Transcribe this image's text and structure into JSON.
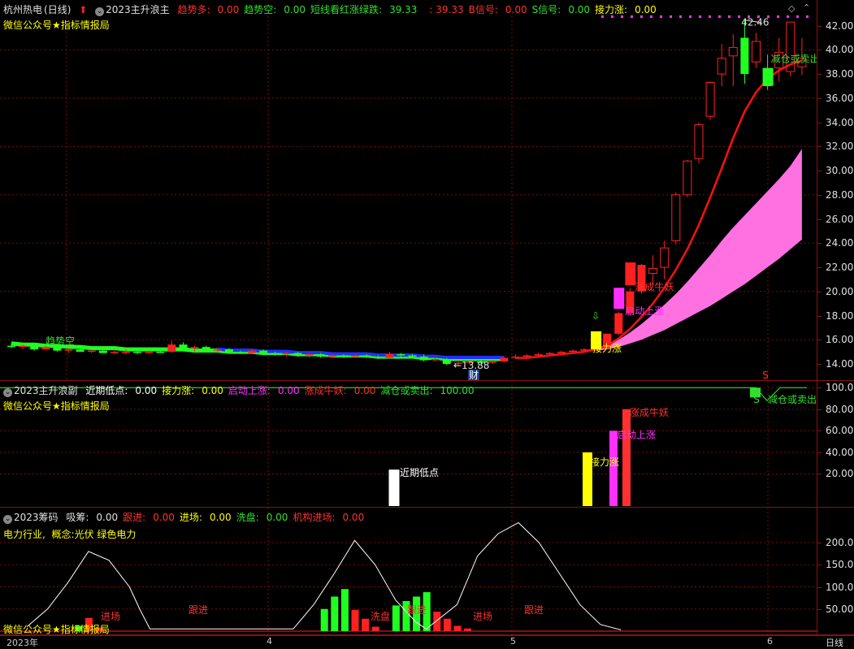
{
  "main_panel": {
    "stock_name": "杭州热电",
    "period": "(日线)",
    "indicator_name": "2023主升浪主",
    "fields": [
      {
        "label": "趋势多:",
        "value": "0.00",
        "color": "#ff3030"
      },
      {
        "label": "趋势空:",
        "value": "0.00",
        "color": "#30e030"
      },
      {
        "label": "短线看红涨绿跌:",
        "value": "39.33",
        "color": "#30e030"
      },
      {
        "label": "",
        "value": ": 39.33",
        "color": "#ff3030"
      },
      {
        "label": "B信号:",
        "value": "0.00",
        "color": "#ff3030"
      },
      {
        "label": "S信号:",
        "value": "0.00",
        "color": "#30e030"
      },
      {
        "label": "接力涨:",
        "value": "0.00",
        "color": "#ffff00"
      }
    ],
    "subtitle": "微信公众号★指标情报局",
    "annotations": {
      "high": "42.46",
      "low": "13.88",
      "trend_empty": "趋势空",
      "relay": "接力涨",
      "start": "启动上涨",
      "bull": "涨成牛妖",
      "reduce": "减仓或卖出",
      "cai": "财",
      "s_mark": "S"
    },
    "y_ticks": [
      "42.00",
      "40.00",
      "38.00",
      "36.00",
      "34.00",
      "32.00",
      "30.00",
      "28.00",
      "26.00",
      "24.00",
      "22.00",
      "20.00",
      "18.00",
      "16.00",
      "14.00"
    ]
  },
  "sub_panel": {
    "indicator_name": "2023主升浪副",
    "fields": [
      {
        "label": "近期低点:",
        "value": "0.00",
        "color": "#ffffff"
      },
      {
        "label": "接力涨:",
        "value": "0.00",
        "color": "#ffff00"
      },
      {
        "label": "启动上涨:",
        "value": "0.00",
        "color": "#ff30ff"
      },
      {
        "label": "涨成牛妖:",
        "value": "0.00",
        "color": "#ff3030"
      },
      {
        "label": "减仓或卖出:",
        "value": "100.00",
        "color": "#30e030"
      }
    ],
    "subtitle": "微信公众号★指标情报局",
    "annotations": {
      "recent_low": "近期低点",
      "relay": "接力涨",
      "start": "启动上涨",
      "bull": "涨成牛妖",
      "reduce": "减仓或卖出",
      "s_mark": "S"
    },
    "y_ticks": [
      "100.00",
      "80.00",
      "60.00",
      "40.00",
      "20.00"
    ]
  },
  "chip_panel": {
    "indicator_name": "2023筹码",
    "fields": [
      {
        "label": "吸筹:",
        "value": "0.00",
        "color": "#e0e0e0"
      },
      {
        "label": "跟进:",
        "value": "0.00",
        "color": "#ff3030"
      },
      {
        "label": "进场:",
        "value": "0.00",
        "color": "#ffff00"
      },
      {
        "label": "洗盘:",
        "value": "0.00",
        "color": "#30e030"
      },
      {
        "label": "机构进场:",
        "value": "0.00",
        "color": "#ff3030"
      }
    ],
    "industry": "电力行业,",
    "concept": "概念:光伏 绿色电力",
    "footer": "微信公众号★指标情报局",
    "annotations": {
      "enter1": "进场",
      "follow1": "跟进",
      "wash": "洗盘",
      "follow2": "跟进",
      "enter2": "进场",
      "follow3": "跟进"
    },
    "y_ticks": [
      "200.0",
      "150.0",
      "100.0",
      "50.00"
    ]
  },
  "time_axis": {
    "labels": [
      "2023年",
      "4",
      "5",
      "6"
    ],
    "period_button": "日线"
  },
  "colors": {
    "up": "#ff2020",
    "down": "#20ff20",
    "blue": "#2020ff",
    "pink": "#ff70e0",
    "magenta": "#ff30ff",
    "yellow": "#ffff00",
    "grid": "#8a1010"
  },
  "chart_data": [
    {
      "type": "candlestick",
      "title": "2023主升浪主",
      "ylim": [
        13,
        43
      ],
      "candles": [
        {
          "o": 15.5,
          "h": 15.7,
          "l": 15.3,
          "c": 15.4
        },
        {
          "o": 15.4,
          "h": 15.6,
          "l": 15.2,
          "c": 15.5
        },
        {
          "o": 15.5,
          "h": 15.6,
          "l": 15.1,
          "c": 15.2
        },
        {
          "o": 15.2,
          "h": 15.5,
          "l": 15.1,
          "c": 15.4
        },
        {
          "o": 15.4,
          "h": 15.5,
          "l": 15.0,
          "c": 15.1
        },
        {
          "o": 15.1,
          "h": 15.3,
          "l": 14.9,
          "c": 15.2
        },
        {
          "o": 15.2,
          "h": 15.4,
          "l": 15.0,
          "c": 15.0
        },
        {
          "o": 15.0,
          "h": 15.2,
          "l": 14.9,
          "c": 15.1
        },
        {
          "o": 15.1,
          "h": 15.3,
          "l": 14.9,
          "c": 14.9
        },
        {
          "o": 14.9,
          "h": 15.2,
          "l": 14.8,
          "c": 15.0
        },
        {
          "o": 15.0,
          "h": 15.2,
          "l": 14.8,
          "c": 15.0
        },
        {
          "o": 15.0,
          "h": 15.1,
          "l": 14.8,
          "c": 14.9
        },
        {
          "o": 14.9,
          "h": 15.1,
          "l": 14.8,
          "c": 15.0
        },
        {
          "o": 15.0,
          "h": 15.2,
          "l": 14.9,
          "c": 14.9
        },
        {
          "o": 15.0,
          "h": 15.9,
          "l": 14.9,
          "c": 15.6
        },
        {
          "o": 15.6,
          "h": 15.8,
          "l": 15.2,
          "c": 15.3
        },
        {
          "o": 15.3,
          "h": 15.5,
          "l": 15.0,
          "c": 15.4
        },
        {
          "o": 15.4,
          "h": 15.5,
          "l": 15.0,
          "c": 15.1
        },
        {
          "o": 15.1,
          "h": 15.3,
          "l": 14.9,
          "c": 15.2
        },
        {
          "o": 15.2,
          "h": 15.3,
          "l": 14.9,
          "c": 15.0
        },
        {
          "o": 15.0,
          "h": 15.1,
          "l": 14.8,
          "c": 14.9
        },
        {
          "o": 14.9,
          "h": 15.2,
          "l": 14.8,
          "c": 15.1
        },
        {
          "o": 15.1,
          "h": 15.2,
          "l": 14.8,
          "c": 14.9
        },
        {
          "o": 14.9,
          "h": 15.0,
          "l": 14.7,
          "c": 14.8
        },
        {
          "o": 14.8,
          "h": 15.0,
          "l": 14.6,
          "c": 14.9
        },
        {
          "o": 14.9,
          "h": 15.0,
          "l": 14.6,
          "c": 14.7
        },
        {
          "o": 14.7,
          "h": 14.9,
          "l": 14.5,
          "c": 14.8
        },
        {
          "o": 14.8,
          "h": 14.9,
          "l": 14.5,
          "c": 14.6
        },
        {
          "o": 14.6,
          "h": 14.8,
          "l": 14.5,
          "c": 14.7
        },
        {
          "o": 14.7,
          "h": 14.8,
          "l": 14.5,
          "c": 14.6
        },
        {
          "o": 14.6,
          "h": 14.8,
          "l": 14.5,
          "c": 14.7
        },
        {
          "o": 14.7,
          "h": 14.8,
          "l": 14.5,
          "c": 14.6
        },
        {
          "o": 14.6,
          "h": 14.7,
          "l": 14.4,
          "c": 14.5
        },
        {
          "o": 14.5,
          "h": 15.0,
          "l": 14.4,
          "c": 14.8
        },
        {
          "o": 14.8,
          "h": 14.9,
          "l": 14.6,
          "c": 14.7
        },
        {
          "o": 14.7,
          "h": 14.8,
          "l": 14.5,
          "c": 14.6
        },
        {
          "o": 14.6,
          "h": 14.8,
          "l": 14.2,
          "c": 14.3
        },
        {
          "o": 14.3,
          "h": 14.5,
          "l": 14.2,
          "c": 14.4
        },
        {
          "o": 14.4,
          "h": 14.5,
          "l": 13.9,
          "c": 14.0
        },
        {
          "o": 14.0,
          "h": 14.3,
          "l": 13.88,
          "c": 14.1
        },
        {
          "o": 14.1,
          "h": 14.3,
          "l": 14.0,
          "c": 14.2
        },
        {
          "o": 14.2,
          "h": 14.4,
          "l": 14.0,
          "c": 14.1
        },
        {
          "o": 14.1,
          "h": 14.3,
          "l": 14.0,
          "c": 14.2
        },
        {
          "o": 14.2,
          "h": 14.6,
          "l": 14.1,
          "c": 14.5
        },
        {
          "o": 14.5,
          "h": 14.8,
          "l": 14.4,
          "c": 14.6
        },
        {
          "o": 14.6,
          "h": 14.8,
          "l": 14.5,
          "c": 14.7
        },
        {
          "o": 14.7,
          "h": 14.9,
          "l": 14.6,
          "c": 14.8
        },
        {
          "o": 14.8,
          "h": 15.0,
          "l": 14.7,
          "c": 14.9
        },
        {
          "o": 14.9,
          "h": 15.1,
          "l": 14.8,
          "c": 15.0
        },
        {
          "o": 15.0,
          "h": 15.2,
          "l": 14.9,
          "c": 15.1
        },
        {
          "o": 15.1,
          "h": 15.3,
          "l": 15.0,
          "c": 15.2
        },
        {
          "o": 15.2,
          "h": 15.3,
          "l": 15.1,
          "c": 15.3
        },
        {
          "o": 15.3,
          "h": 16.5,
          "l": 15.2,
          "c": 16.5
        },
        {
          "o": 16.5,
          "h": 18.3,
          "l": 16.4,
          "c": 18.2
        },
        {
          "o": 18.2,
          "h": 20.3,
          "l": 18.0,
          "c": 20.0
        },
        {
          "o": 20.0,
          "h": 22.3,
          "l": 19.8,
          "c": 22.2
        },
        {
          "o": 21.5,
          "h": 23.0,
          "l": 20.4,
          "c": 21.9
        },
        {
          "o": 22.0,
          "h": 24.2,
          "l": 21.0,
          "c": 23.6
        },
        {
          "o": 24.2,
          "h": 28.2,
          "l": 23.9,
          "c": 28.0
        },
        {
          "o": 28.0,
          "h": 30.9,
          "l": 27.8,
          "c": 30.8
        },
        {
          "o": 31.0,
          "h": 34.0,
          "l": 30.6,
          "c": 33.8
        },
        {
          "o": 34.5,
          "h": 37.4,
          "l": 34.2,
          "c": 37.3
        },
        {
          "o": 38.0,
          "h": 40.5,
          "l": 37.0,
          "c": 39.3
        },
        {
          "o": 39.5,
          "h": 41.3,
          "l": 37.0,
          "c": 40.2
        },
        {
          "o": 41.0,
          "h": 42.46,
          "l": 37.2,
          "c": 38.0
        },
        {
          "o": 39.0,
          "h": 41.4,
          "l": 38.5,
          "c": 40.7
        },
        {
          "o": 38.3,
          "h": 39.6,
          "l": 36.7,
          "c": 37.0
        },
        {
          "o": 38.5,
          "h": 41.0,
          "l": 37.4,
          "c": 39.8
        },
        {
          "o": 38.2,
          "h": 42.3,
          "l": 37.8,
          "c": 42.3
        },
        {
          "o": 38.6,
          "h": 41.0,
          "l": 37.9,
          "c": 39.3
        }
      ],
      "ma_line": [
        15.7,
        15.6,
        15.6,
        15.5,
        15.5,
        15.4,
        15.4,
        15.3,
        15.3,
        15.3,
        15.2,
        15.2,
        15.2,
        15.2,
        15.2,
        15.2,
        15.1,
        15.1,
        15.1,
        15.0,
        15.0,
        15.0,
        14.9,
        14.9,
        14.9,
        14.8,
        14.8,
        14.8,
        14.7,
        14.7,
        14.7,
        14.7,
        14.6,
        14.6,
        14.6,
        14.6,
        14.5,
        14.5,
        14.4,
        14.4,
        14.4,
        14.4,
        14.4,
        14.4,
        14.5,
        14.5,
        14.6,
        14.7,
        14.8,
        14.9,
        15.0,
        15.2,
        15.5,
        16.1,
        16.9,
        17.9,
        19.0,
        20.3,
        21.8,
        23.5,
        25.5,
        27.8,
        30.2,
        32.7,
        34.9,
        36.5,
        37.6,
        38.3,
        38.8,
        39.1
      ],
      "band_upper": [
        15.8,
        15.7,
        15.7,
        15.6,
        15.6,
        15.5,
        15.5,
        15.4,
        15.4,
        15.4,
        15.3,
        15.3,
        15.3,
        15.3,
        15.3,
        15.3,
        15.2,
        15.2,
        15.2,
        15.1,
        15.1,
        15.1,
        15.0,
        15.0,
        15.0,
        14.9,
        14.9,
        14.9,
        14.8,
        14.8,
        14.8,
        14.8,
        14.7,
        14.7,
        14.7,
        14.7,
        14.6,
        14.6,
        14.6,
        14.5,
        14.5,
        14.5,
        14.5,
        14.5,
        14.6,
        14.6,
        14.7,
        14.8,
        14.9,
        15.0,
        15.1,
        15.3,
        15.6,
        16.0,
        16.6,
        17.3,
        18.1,
        18.9,
        19.8,
        20.8,
        21.9,
        23.0,
        24.2,
        25.3,
        26.3,
        27.3,
        28.3,
        29.3,
        30.4,
        31.8
      ],
      "band_lower": [
        15.8,
        15.7,
        15.7,
        15.6,
        15.6,
        15.5,
        15.5,
        15.4,
        15.4,
        15.4,
        15.3,
        15.3,
        15.3,
        15.3,
        15.3,
        15.3,
        15.2,
        15.2,
        15.2,
        15.1,
        15.1,
        15.1,
        15.0,
        15.0,
        15.0,
        14.9,
        14.9,
        14.9,
        14.8,
        14.8,
        14.8,
        14.8,
        14.7,
        14.7,
        14.7,
        14.7,
        14.6,
        14.6,
        14.6,
        14.5,
        14.5,
        14.5,
        14.5,
        14.5,
        14.6,
        14.6,
        14.7,
        14.8,
        14.9,
        15.0,
        15.0,
        15.1,
        15.2,
        15.4,
        15.7,
        16.0,
        16.4,
        16.8,
        17.3,
        17.8,
        18.3,
        18.8,
        19.4,
        20.0,
        20.6,
        21.3,
        22.0,
        22.7,
        23.5,
        24.3
      ],
      "high_label": "42.46",
      "low_label": "13.88"
    },
    {
      "type": "bar",
      "title": "2023主升浪副",
      "ylim": [
        0,
        110
      ],
      "series": [
        {
          "name": "近期低点",
          "color": "#ffffff",
          "index": 39,
          "value": 24
        },
        {
          "name": "接力涨",
          "color": "#ffff00",
          "index": 52,
          "value": 40
        },
        {
          "name": "启动上涨",
          "color": "#ff30ff",
          "index": 54,
          "value": 60
        },
        {
          "name": "涨成牛妖",
          "color": "#ff3030",
          "index": 55,
          "value": 80
        },
        {
          "name": "减仓或卖出",
          "color": "#30e030",
          "index": 66,
          "value": 100
        }
      ]
    },
    {
      "type": "bar",
      "title": "2023筹码",
      "ylim": [
        0,
        260
      ],
      "line": [
        {
          "i": 2,
          "v": 10
        },
        {
          "i": 4,
          "v": 50
        },
        {
          "i": 6,
          "v": 110
        },
        {
          "i": 8,
          "v": 180
        },
        {
          "i": 10,
          "v": 160
        },
        {
          "i": 12,
          "v": 100
        },
        {
          "i": 13,
          "v": 50
        },
        {
          "i": 14,
          "v": 5
        },
        {
          "i": 28,
          "v": 5
        },
        {
          "i": 30,
          "v": 60
        },
        {
          "i": 32,
          "v": 130
        },
        {
          "i": 34,
          "v": 205
        },
        {
          "i": 36,
          "v": 150
        },
        {
          "i": 38,
          "v": 70
        },
        {
          "i": 40,
          "v": 20
        },
        {
          "i": 41,
          "v": 5
        },
        {
          "i": 44,
          "v": 60
        },
        {
          "i": 46,
          "v": 170
        },
        {
          "i": 48,
          "v": 220
        },
        {
          "i": 50,
          "v": 245
        },
        {
          "i": 52,
          "v": 200
        },
        {
          "i": 54,
          "v": 130
        },
        {
          "i": 56,
          "v": 60
        },
        {
          "i": 58,
          "v": 15
        },
        {
          "i": 60,
          "v": 3
        }
      ],
      "bars": [
        {
          "i": 7,
          "v": 12,
          "c": "green"
        },
        {
          "i": 8,
          "v": 30,
          "c": "red"
        },
        {
          "i": 9,
          "v": 8,
          "c": "red"
        },
        {
          "i": 31,
          "v": 50,
          "c": "green"
        },
        {
          "i": 32,
          "v": 78,
          "c": "green"
        },
        {
          "i": 33,
          "v": 95,
          "c": "green"
        },
        {
          "i": 34,
          "v": 48,
          "c": "red"
        },
        {
          "i": 35,
          "v": 28,
          "c": "red"
        },
        {
          "i": 36,
          "v": 10,
          "c": "red"
        },
        {
          "i": 38,
          "v": 58,
          "c": "green"
        },
        {
          "i": 39,
          "v": 68,
          "c": "green"
        },
        {
          "i": 40,
          "v": 78,
          "c": "green"
        },
        {
          "i": 41,
          "v": 88,
          "c": "green"
        },
        {
          "i": 42,
          "v": 44,
          "c": "red"
        },
        {
          "i": 43,
          "v": 28,
          "c": "red"
        },
        {
          "i": 44,
          "v": 12,
          "c": "red"
        },
        {
          "i": 45,
          "v": 6,
          "c": "red"
        }
      ]
    }
  ]
}
